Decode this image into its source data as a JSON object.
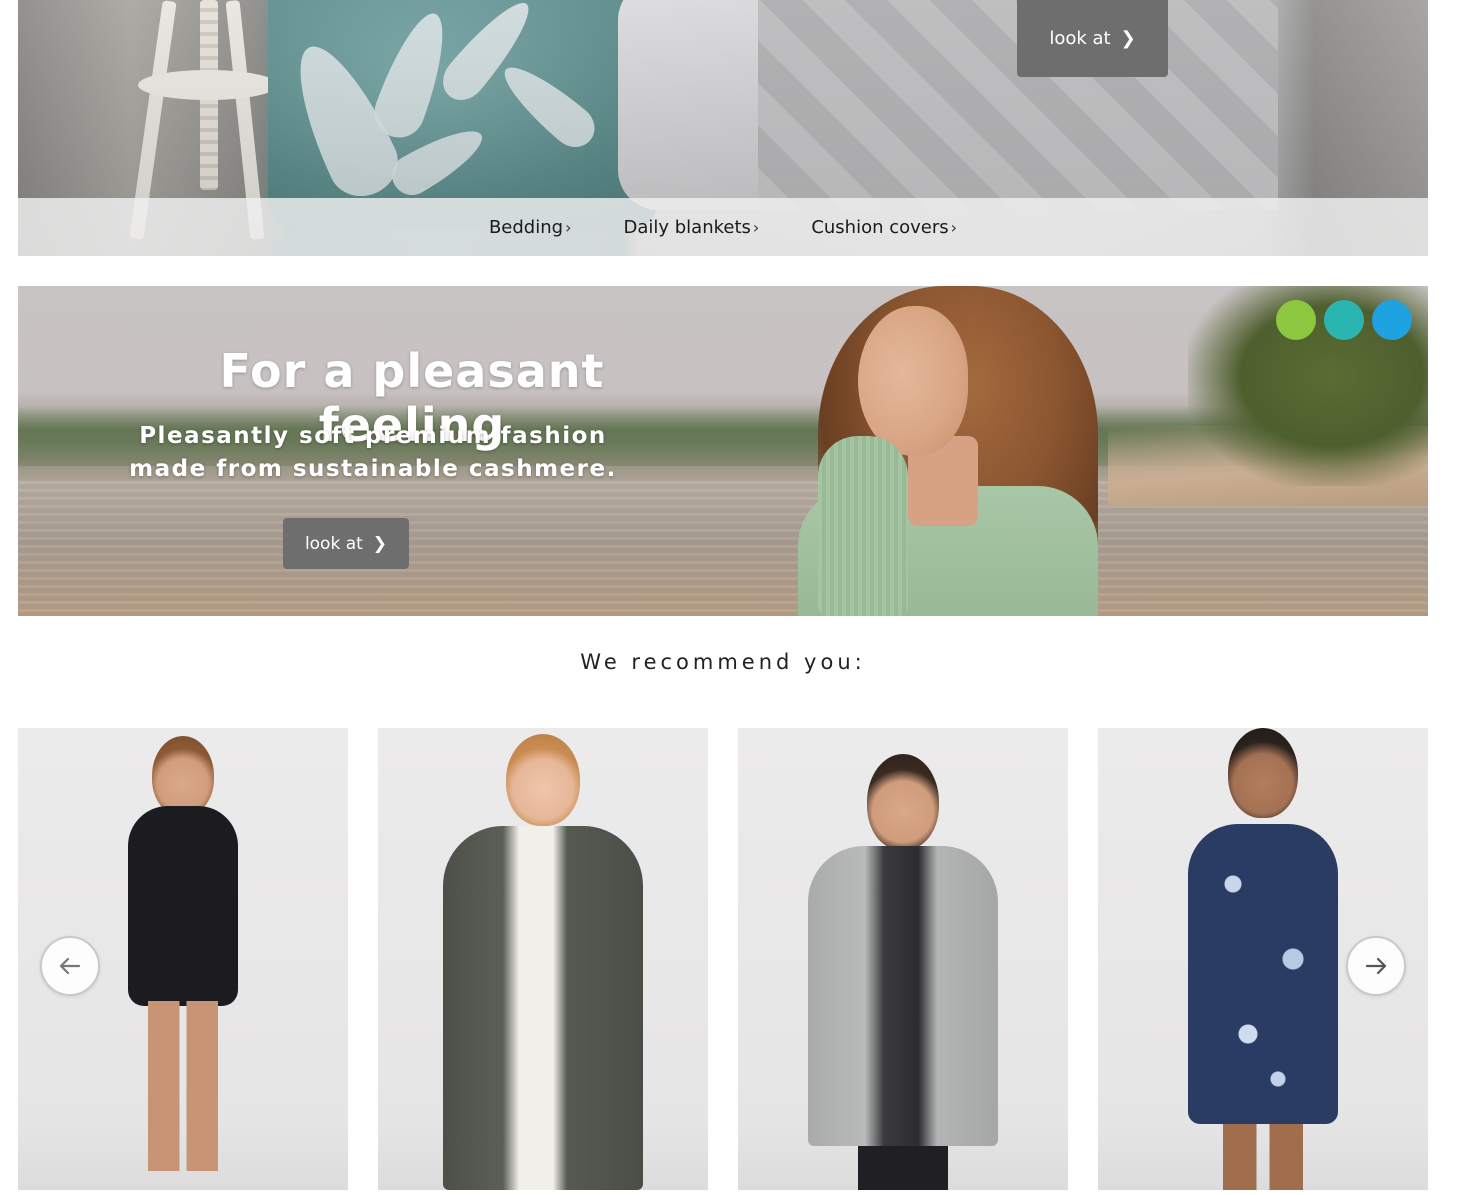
{
  "bedding_banner": {
    "look_button": "look at",
    "links": [
      {
        "label": "Bedding"
      },
      {
        "label": "Daily blankets"
      },
      {
        "label": "Cushion covers"
      }
    ]
  },
  "cashmere_banner": {
    "title": "For a pleasant feeling",
    "subtitle_line1": "Pleasantly soft premium fashion",
    "subtitle_line2": "made from sustainable cashmere.",
    "look_button": "look at",
    "color_dots": [
      "#8dc63f",
      "#2bb5b0",
      "#1fa3e0"
    ]
  },
  "recommend": {
    "heading": "We recommend you:",
    "products": [
      {
        "icon": "black-wrap-dress-image"
      },
      {
        "icon": "dark-green-long-cardigan-image"
      },
      {
        "icon": "grey-long-cardigan-image"
      },
      {
        "icon": "blue-floral-dress-image"
      }
    ],
    "prev_icon": "arrow-left-icon",
    "next_icon": "arrow-right-icon"
  }
}
